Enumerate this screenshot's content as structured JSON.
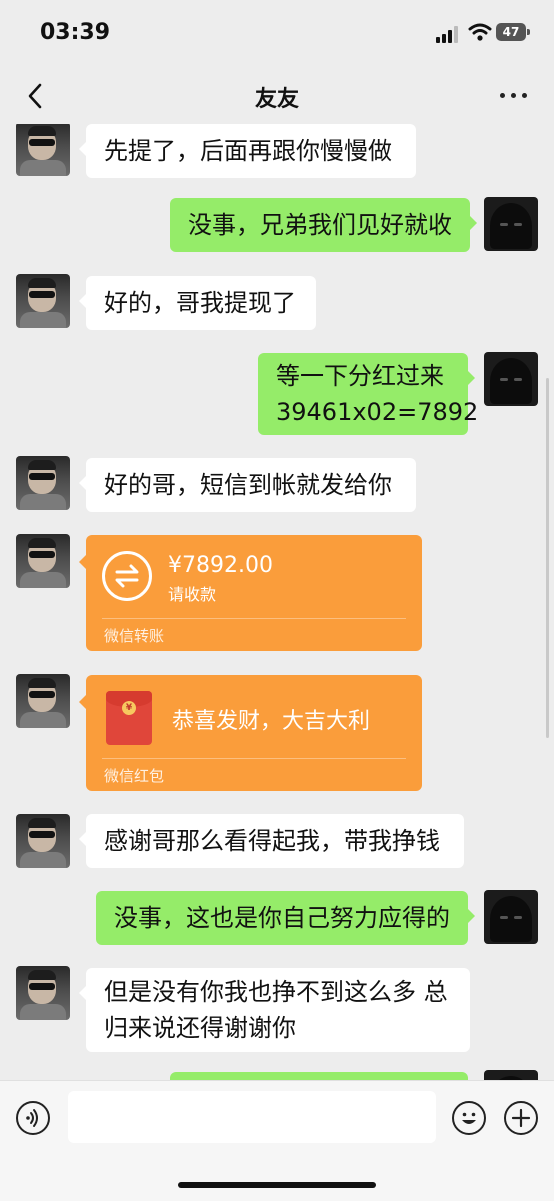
{
  "status": {
    "time": "03:39",
    "battery": "47"
  },
  "nav": {
    "title": "友友"
  },
  "messages": [
    {
      "side": "in",
      "text": "先提了，后面再跟你慢慢做"
    },
    {
      "side": "out",
      "text": "没事，兄弟我们见好就收"
    },
    {
      "side": "in",
      "text": "好的，哥我提现了"
    },
    {
      "side": "out",
      "line1": "等一下分红过来",
      "line2": "39461x02=7892"
    },
    {
      "side": "in",
      "text": "好的哥，短信到帐就发给你"
    },
    {
      "side": "in",
      "type": "transfer",
      "amount": "¥7892.00",
      "label": "请收款",
      "footer": "微信转账"
    },
    {
      "side": "in",
      "type": "red_packet",
      "wish": "恭喜发财，大吉大利",
      "footer": "微信红包",
      "coin": "¥"
    },
    {
      "side": "in",
      "text": "感谢哥那么看得起我，带我挣钱"
    },
    {
      "side": "out",
      "text": "没事，这也是你自己努力应得的"
    },
    {
      "side": "in",
      "line1": "但是没有你我也挣不到这么多 总",
      "line2": "归来说还得谢谢你"
    }
  ],
  "input": {
    "value": ""
  },
  "colors": {
    "incoming": "#ffffff",
    "outgoing": "#95ec69",
    "transfer": "#fa9d3b",
    "background": "#ededed"
  }
}
